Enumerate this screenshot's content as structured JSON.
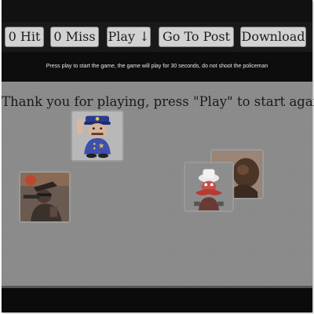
{
  "toolbar": {
    "hit_label": "0 Hit",
    "miss_label": "0 Miss",
    "play_label": "Play ↓",
    "post_label": "Go To Post",
    "download_label": "Download"
  },
  "instructions": "Press play to start the game, the game will play for 30 seconds, do not shoot the policeman",
  "game": {
    "message": "Thank you for playing, press \"Play\" to start again.",
    "targets": [
      "policeman-icon",
      "bandit-icon",
      "cartoon-character-icon"
    ]
  },
  "colors": {
    "toolbar_bg": "#191919",
    "game_area_bg": "#898989",
    "button_bg": "#d2d2d2",
    "instruction_text": "#e8e8e8"
  }
}
